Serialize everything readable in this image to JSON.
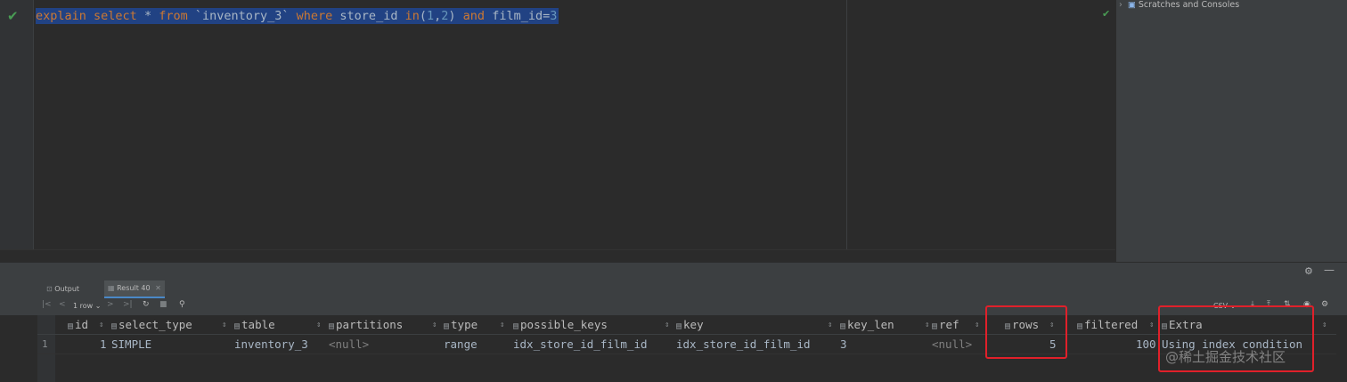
{
  "editor": {
    "tokens": [
      {
        "t": "explain",
        "c": "kw"
      },
      {
        "t": " ",
        "c": "id"
      },
      {
        "t": "select",
        "c": "kw"
      },
      {
        "t": " * ",
        "c": "id"
      },
      {
        "t": "from",
        "c": "kw"
      },
      {
        "t": " `inventory_3` ",
        "c": "str"
      },
      {
        "t": "where",
        "c": "kw"
      },
      {
        "t": " store_id ",
        "c": "id"
      },
      {
        "t": "in",
        "c": "kw"
      },
      {
        "t": "(",
        "c": "id"
      },
      {
        "t": "1",
        "c": "num"
      },
      {
        "t": ",",
        "c": "id"
      },
      {
        "t": "2",
        "c": "num"
      },
      {
        "t": ") ",
        "c": "id"
      },
      {
        "t": "and",
        "c": "kw"
      },
      {
        "t": " film_id=",
        "c": "id"
      },
      {
        "t": "3",
        "c": "num"
      }
    ]
  },
  "right_panel": {
    "scratches": "Scratches and Consoles"
  },
  "tabs": {
    "output": "Output",
    "result": "Result 40"
  },
  "toolbar": {
    "rows": "1 row",
    "export": "CSV"
  },
  "grid": {
    "columns": [
      "id",
      "select_type",
      "table",
      "partitions",
      "type",
      "possible_keys",
      "key",
      "key_len",
      "ref",
      "rows",
      "filtered",
      "Extra"
    ],
    "row_number": "1",
    "row": {
      "id": "1",
      "select_type": "SIMPLE",
      "table": "inventory_3",
      "partitions": "<null>",
      "type": "range",
      "possible_keys": "idx_store_id_film_id",
      "key": "idx_store_id_film_id",
      "key_len": "3",
      "ref": "<null>",
      "rows": "5",
      "filtered": "100",
      "Extra": "Using index condition"
    }
  },
  "watermark": "@稀土掘金技术社区",
  "colors": {
    "highlight_box": "#e0202a",
    "selection": "#214283",
    "keyword": "#cc7832",
    "number": "#6897bb"
  }
}
